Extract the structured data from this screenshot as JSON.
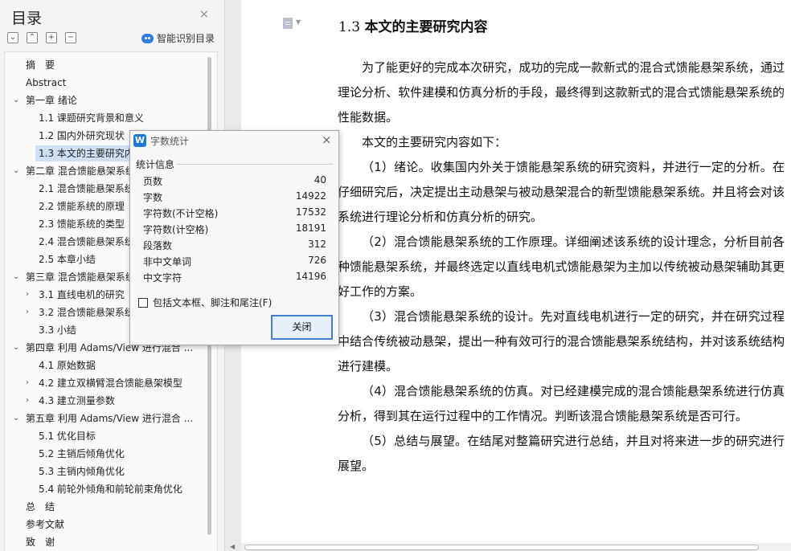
{
  "toc": {
    "title": "目录",
    "close_icon": "×",
    "tools": [
      "⌄",
      "⌃",
      "+",
      "−"
    ],
    "smart_label": "智能识别目录",
    "items": [
      {
        "label": "摘　要",
        "level": 0,
        "chevron": ""
      },
      {
        "label": "Abstract",
        "level": 0,
        "chevron": ""
      },
      {
        "label": "第一章 绪论",
        "level": 0,
        "chevron": "⌄"
      },
      {
        "label": "1.1 课题研究背景和意义",
        "level": 1,
        "chevron": ""
      },
      {
        "label": "1.2 国内外研究现状",
        "level": 1,
        "chevron": ""
      },
      {
        "label": "1.3 本文的主要研究内容",
        "level": 1,
        "chevron": "",
        "selected": true
      },
      {
        "label": "第二章 混合馈能悬架系统",
        "level": 0,
        "chevron": "⌄"
      },
      {
        "label": "2.1 混合馈能悬架系统",
        "level": 1,
        "chevron": ""
      },
      {
        "label": "2.2 馈能系统的原理",
        "level": 1,
        "chevron": ""
      },
      {
        "label": "2.3 馈能系统的类型",
        "level": 1,
        "chevron": ""
      },
      {
        "label": "2.4 混合馈能悬架系统",
        "level": 1,
        "chevron": ""
      },
      {
        "label": "2.5 本章小结",
        "level": 1,
        "chevron": ""
      },
      {
        "label": "第三章 混合馈能悬架系统",
        "level": 0,
        "chevron": "⌄"
      },
      {
        "label": "3.1 直线电机的研究",
        "level": 1,
        "chevron": "›"
      },
      {
        "label": "3.2 混合馈能悬架系统",
        "level": 1,
        "chevron": "›"
      },
      {
        "label": "3.3 小结",
        "level": 1,
        "chevron": ""
      },
      {
        "label": "第四章 利用 Adams/View 进行混合 ...",
        "level": 0,
        "chevron": "⌄"
      },
      {
        "label": "4.1 原始数据",
        "level": 1,
        "chevron": ""
      },
      {
        "label": "4.2 建立双横臂混合馈能悬架模型",
        "level": 1,
        "chevron": "›"
      },
      {
        "label": "4.3 建立测量参数",
        "level": 1,
        "chevron": "›"
      },
      {
        "label": "第五章 利用 Adams/View 进行混合 ...",
        "level": 0,
        "chevron": "⌄"
      },
      {
        "label": "5.1 优化目标",
        "level": 1,
        "chevron": ""
      },
      {
        "label": "5.2 主销后倾角优化",
        "level": 1,
        "chevron": ""
      },
      {
        "label": "5.3 主销内倾角优化",
        "level": 1,
        "chevron": ""
      },
      {
        "label": "5.4 前轮外倾角和前轮前束角优化",
        "level": 1,
        "chevron": ""
      },
      {
        "label": "总　结",
        "level": 0,
        "chevron": ""
      },
      {
        "label": "参考文献",
        "level": 0,
        "chevron": ""
      },
      {
        "label": "致　谢",
        "level": 0,
        "chevron": ""
      }
    ]
  },
  "document": {
    "heading_number": "1.3",
    "heading_text": "本文的主要研究内容",
    "paragraphs": [
      "为了能更好的完成本次研究，成功的完成一款新式的混合式馈能悬架系统，通过理论分析、软件建模和仿真分析的手段，最终得到这款新式的混合式馈能悬架系统的性能数据。",
      "本文的主要研究内容如下：",
      "（1）绪论。收集国内外关于馈能悬架系统的研究资料，并进行一定的分析。在仔细研究后，决定提出主动悬架与被动悬架混合的新型馈能悬架系统。并且将会对该系统进行理论分析和仿真分析的研究。",
      "（2）混合馈能悬架系统的工作原理。详细阐述该系统的设计理念，分析目前各种馈能悬架系统，并最终选定以直线电机式馈能悬架为主加以传统被动悬架辅助其更好工作的方案。",
      "（3）混合馈能悬架系统的设计。先对直线电机进行一定的研究，并在研究过程中结合传统被动悬架，提出一种有效可行的混合馈能悬架系统结构，并对该系统结构进行建模。",
      "（4）混合馈能悬架系统的仿真。对已经建模完成的混合馈能悬架系统进行仿真分析，得到其在运行过程中的工作情况。判断该混合馈能悬架系统是否可行。",
      "（5）总结与展望。在结尾对整篇研究进行总结，并且对将来进一步的研究进行展望。"
    ]
  },
  "word_count": {
    "title": "字数统计",
    "logo": "W",
    "close_icon": "×",
    "group_label": "统计信息",
    "rows": [
      {
        "label": "页数",
        "value": "40"
      },
      {
        "label": "字数",
        "value": "14922"
      },
      {
        "label": "字符数(不计空格)",
        "value": "17532"
      },
      {
        "label": "字符数(计空格)",
        "value": "18191"
      },
      {
        "label": "段落数",
        "value": "312"
      },
      {
        "label": "非中文单词",
        "value": "726"
      },
      {
        "label": "中文字符",
        "value": "14196"
      }
    ],
    "checkbox_label": "包括文本框、脚注和尾注(F)",
    "checkbox_checked": false,
    "close_button": "关闭"
  }
}
